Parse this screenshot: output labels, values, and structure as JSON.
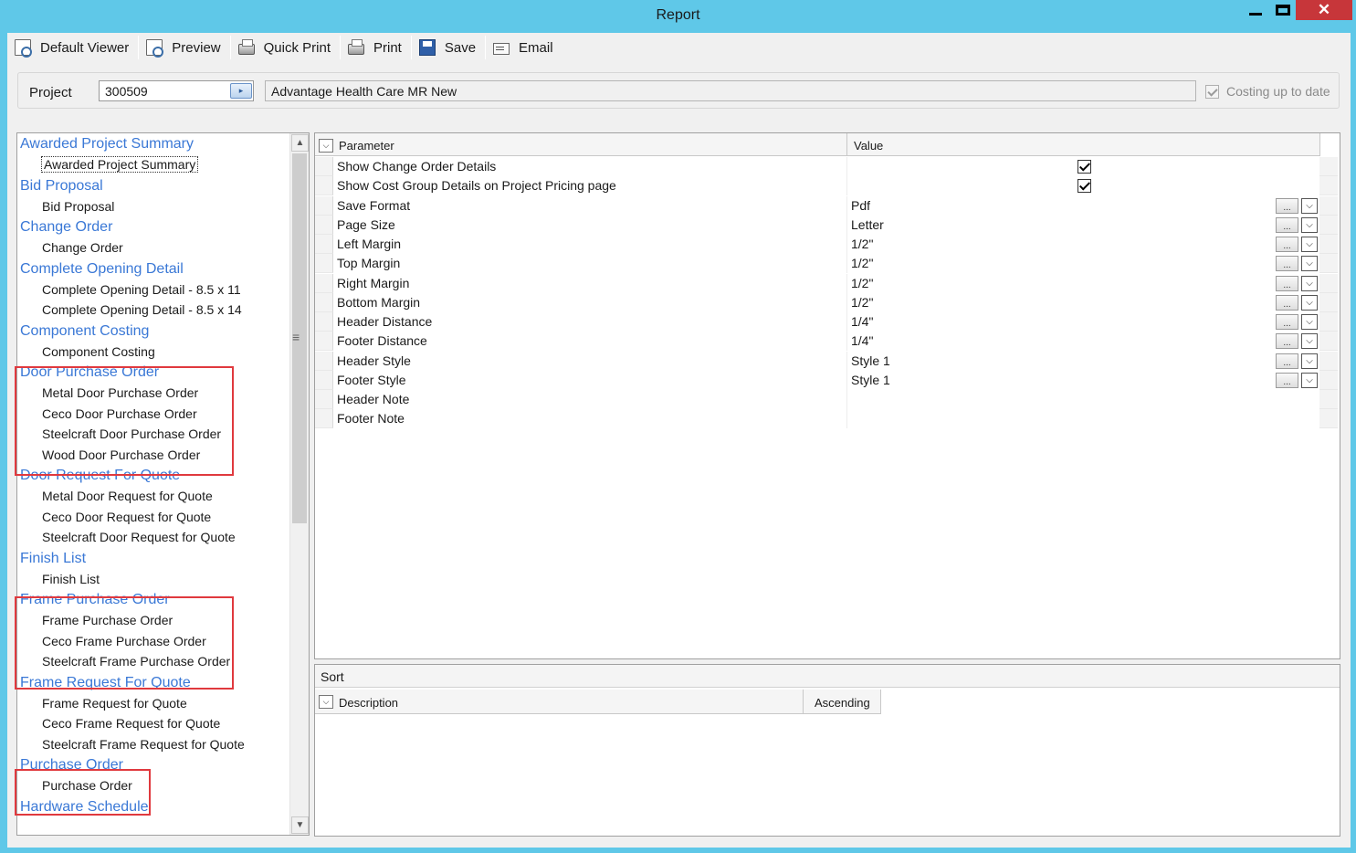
{
  "window": {
    "title": "Report"
  },
  "toolbar": {
    "buttons": [
      {
        "label": "Default Viewer",
        "icon": "page-magnifier-icon"
      },
      {
        "label": "Preview",
        "icon": "preview-icon"
      },
      {
        "label": "Quick Print",
        "icon": "quick-print-icon"
      },
      {
        "label": "Print",
        "icon": "printer-icon"
      },
      {
        "label": "Save",
        "icon": "disk-icon"
      },
      {
        "label": "Email",
        "icon": "email-icon"
      }
    ]
  },
  "project": {
    "label": "Project",
    "number": "300509",
    "name": "Advantage Health Care MR New",
    "costing_label": "Costing up to date",
    "costing_checked": true
  },
  "report_list": {
    "categories": [
      {
        "name": "Awarded Project Summary",
        "items": [
          "Awarded Project Summary"
        ]
      },
      {
        "name": "Bid Proposal",
        "items": [
          "Bid Proposal"
        ]
      },
      {
        "name": "Change Order",
        "items": [
          "Change Order"
        ]
      },
      {
        "name": "Complete Opening Detail",
        "items": [
          "Complete Opening Detail - 8.5 x 11",
          "Complete Opening Detail - 8.5 x 14"
        ]
      },
      {
        "name": "Component Costing",
        "items": [
          "Component Costing"
        ]
      },
      {
        "name": "Door Purchase Order",
        "items": [
          "Metal Door Purchase Order",
          "Ceco Door Purchase Order",
          "Steelcraft Door Purchase Order",
          "Wood Door Purchase Order"
        ]
      },
      {
        "name": "Door Request For Quote",
        "items": [
          "Metal Door Request for Quote",
          "Ceco Door Request for Quote",
          "Steelcraft Door Request for Quote"
        ]
      },
      {
        "name": "Finish List",
        "items": [
          "Finish List"
        ]
      },
      {
        "name": "Frame Purchase Order",
        "items": [
          "Frame Purchase Order",
          "Ceco Frame Purchase Order",
          "Steelcraft Frame Purchase Order"
        ]
      },
      {
        "name": "Frame Request For Quote",
        "items": [
          "Frame Request for Quote",
          "Ceco Frame Request for Quote",
          "Steelcraft Frame Request for Quote"
        ]
      },
      {
        "name": "Purchase Order",
        "items": [
          "Purchase Order"
        ]
      },
      {
        "name": "Hardware Schedule",
        "items": []
      }
    ],
    "selected_item": "Awarded Project Summary"
  },
  "parameters": {
    "header_param": "Parameter",
    "header_value": "Value",
    "rows": [
      {
        "name": "Show Change Order Details",
        "value": "",
        "checkbox": true
      },
      {
        "name": "Show Cost Group Details on Project Pricing page",
        "value": "",
        "checkbox": true
      },
      {
        "name": "Save Format",
        "value": "Pdf",
        "editor": true
      },
      {
        "name": "Page Size",
        "value": "Letter",
        "editor": true
      },
      {
        "name": "Left Margin",
        "value": "1/2\"",
        "editor": true
      },
      {
        "name": "Top Margin",
        "value": "1/2\"",
        "editor": true
      },
      {
        "name": "Right Margin",
        "value": "1/2\"",
        "editor": true
      },
      {
        "name": "Bottom Margin",
        "value": "1/2\"",
        "editor": true
      },
      {
        "name": "Header Distance",
        "value": "1/4\"",
        "editor": true
      },
      {
        "name": "Footer Distance",
        "value": "1/4\"",
        "editor": true
      },
      {
        "name": "Header Style",
        "value": "Style 1",
        "editor": true
      },
      {
        "name": "Footer Style",
        "value": "Style 1",
        "editor": true
      },
      {
        "name": "Header Note",
        "value": ""
      },
      {
        "name": "Footer Note",
        "value": ""
      }
    ]
  },
  "sort": {
    "title": "Sort",
    "col_description": "Description",
    "col_order": "Ascending"
  },
  "colors": {
    "titlebar": "#5fc8e8",
    "category_link": "#3a78d6",
    "highlight": "#e0393e",
    "close_button": "#c7363a"
  }
}
